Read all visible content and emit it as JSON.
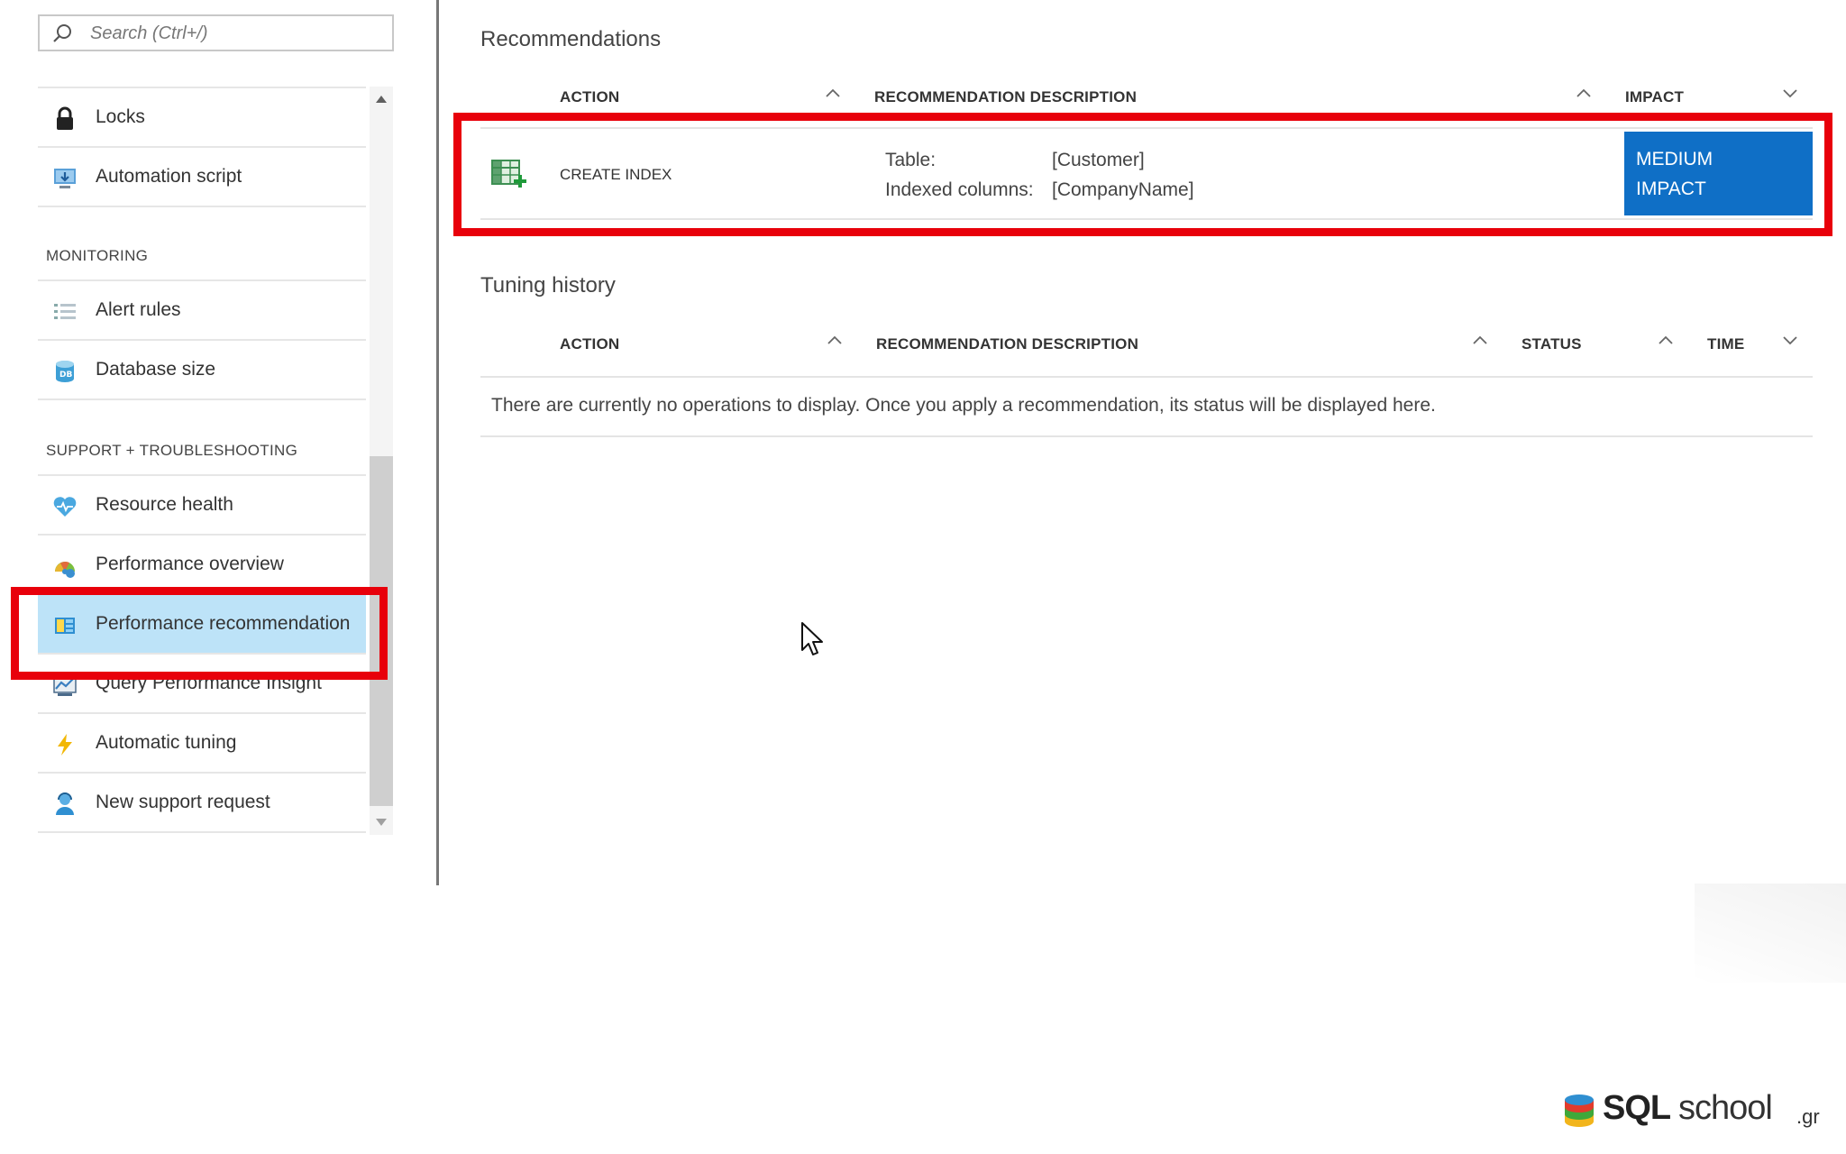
{
  "search": {
    "placeholder": "Search (Ctrl+/)"
  },
  "sidebar": {
    "items_top": [
      {
        "label": "Locks",
        "icon": "lock-icon"
      },
      {
        "label": "Automation script",
        "icon": "automation-script-icon"
      }
    ],
    "monitoring": {
      "title": "MONITORING",
      "items": [
        {
          "label": "Alert rules",
          "icon": "alert-rules-icon"
        },
        {
          "label": "Database size",
          "icon": "database-size-icon"
        }
      ]
    },
    "support": {
      "title": "SUPPORT + TROUBLESHOOTING",
      "items": [
        {
          "label": "Resource health",
          "icon": "heart-icon"
        },
        {
          "label": "Performance overview",
          "icon": "performance-overview-icon"
        },
        {
          "label": "Performance recommendation",
          "icon": "performance-recommendation-icon",
          "active": true
        },
        {
          "label": "Query Performance Insight",
          "icon": "query-insight-icon"
        },
        {
          "label": "Automatic tuning",
          "icon": "lightning-icon"
        },
        {
          "label": "New support request",
          "icon": "support-request-icon"
        }
      ]
    }
  },
  "recommendations": {
    "title": "Recommendations",
    "columns": {
      "action": "ACTION",
      "description": "RECOMMENDATION DESCRIPTION",
      "impact": "IMPACT"
    },
    "rows": [
      {
        "action": "CREATE INDEX",
        "table_label": "Table:",
        "table_value": "[Customer]",
        "columns_label": "Indexed columns:",
        "columns_value": "[CompanyName]",
        "impact_line1": "MEDIUM",
        "impact_line2": "IMPACT"
      }
    ]
  },
  "tuning_history": {
    "title": "Tuning history",
    "columns": {
      "action": "ACTION",
      "description": "RECOMMENDATION DESCRIPTION",
      "status": "STATUS",
      "time": "TIME"
    },
    "empty_message": "There are currently no operations to display. Once you apply a recommendation, its status will be displayed here."
  },
  "logo": {
    "sql": "SQL",
    "school": "school",
    "gr": ".gr"
  },
  "colors": {
    "highlight_red": "#e8000b",
    "active_item_bg": "#bde3f8",
    "impact_blue": "#0f6fc6"
  }
}
